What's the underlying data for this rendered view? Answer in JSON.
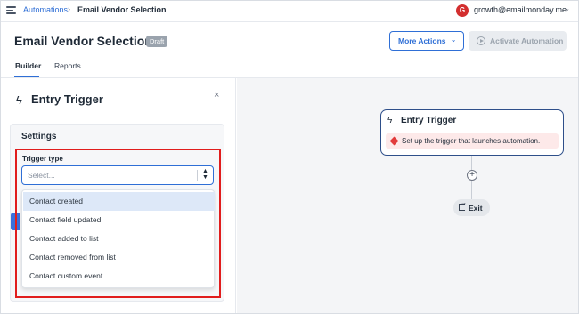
{
  "breadcrumb": {
    "parent": "Automations",
    "separator": "›",
    "current": "Email Vendor Selection"
  },
  "account": {
    "avatar_letter": "G",
    "email": "growth@emailmonday.me",
    "chevron": "⌄"
  },
  "header": {
    "title": "Email Vendor Selection",
    "badge": "Draft",
    "more_actions": "More Actions",
    "more_actions_chevron": "⌄",
    "activate": "Activate Automation"
  },
  "tabs": [
    {
      "label": "Builder",
      "active": true
    },
    {
      "label": "Reports",
      "active": false
    }
  ],
  "panel": {
    "icon": "ϟ",
    "title": "Entry Trigger",
    "close": "×",
    "settings_label": "Settings",
    "trigger_type_label": "Trigger type",
    "select_placeholder": "Select...",
    "select_arrows": "▲▼",
    "options": [
      {
        "label": "Contact created",
        "selected": true
      },
      {
        "label": "Contact field updated",
        "selected": false
      },
      {
        "label": "Contact added to list",
        "selected": false
      },
      {
        "label": "Contact removed from list",
        "selected": false
      },
      {
        "label": "Contact custom event",
        "selected": false
      }
    ]
  },
  "canvas": {
    "node_icon": "ϟ",
    "node_title": "Entry Trigger",
    "warning": "Set up the trigger that launches automation.",
    "plus": "+",
    "exit_label": "Exit"
  },
  "colors": {
    "accent": "#2f6fd6",
    "highlight": "#e11d1d",
    "warning_bg": "#fde9e9",
    "avatar": "#d32f2f"
  }
}
